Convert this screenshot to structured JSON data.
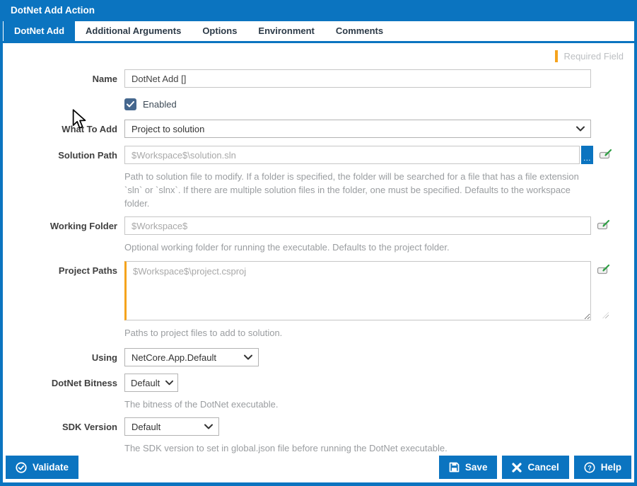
{
  "window": {
    "title": "DotNet Add Action"
  },
  "tabs": [
    {
      "label": "DotNet Add",
      "active": true
    },
    {
      "label": "Additional Arguments",
      "active": false
    },
    {
      "label": "Options",
      "active": false
    },
    {
      "label": "Environment",
      "active": false
    },
    {
      "label": "Comments",
      "active": false
    }
  ],
  "legend": {
    "required_label": "Required Field"
  },
  "form": {
    "name": {
      "label": "Name",
      "value": "DotNet Add []"
    },
    "enabled": {
      "label": "Enabled",
      "checked": true
    },
    "what_to_add": {
      "label": "What To Add",
      "value": "Project to solution"
    },
    "solution_path": {
      "label": "Solution Path",
      "placeholder": "$Workspace$\\solution.sln",
      "browse_label": "...",
      "help": "Path to solution file to modify. If a folder is specified, the folder will be searched for a file that has a file extension `sln` or `slnx`. If there are multiple solution files in the folder, one must be specified. Defaults to the workspace folder."
    },
    "working_folder": {
      "label": "Working Folder",
      "placeholder": "$Workspace$",
      "help": "Optional working folder for running the executable. Defaults to the project folder."
    },
    "project_paths": {
      "label": "Project Paths",
      "placeholder": "$Workspace$\\project.csproj",
      "help": "Paths to project files to add to solution.",
      "required": true
    },
    "using": {
      "label": "Using",
      "value": "NetCore.App.Default"
    },
    "bitness": {
      "label": "DotNet Bitness",
      "value": "Default",
      "help": "The bitness of the DotNet executable."
    },
    "sdk_version": {
      "label": "SDK Version",
      "value": "Default",
      "help": "The SDK version to set in global.json file before running the DotNet executable."
    }
  },
  "footer": {
    "validate_label": "Validate",
    "save_label": "Save",
    "cancel_label": "Cancel",
    "help_label": "Help"
  },
  "colors": {
    "accent_blue": "#0b74c0",
    "required_orange": "#f5a31d",
    "checkbox_blue": "#45678e",
    "help_gray": "#9a9da0"
  }
}
